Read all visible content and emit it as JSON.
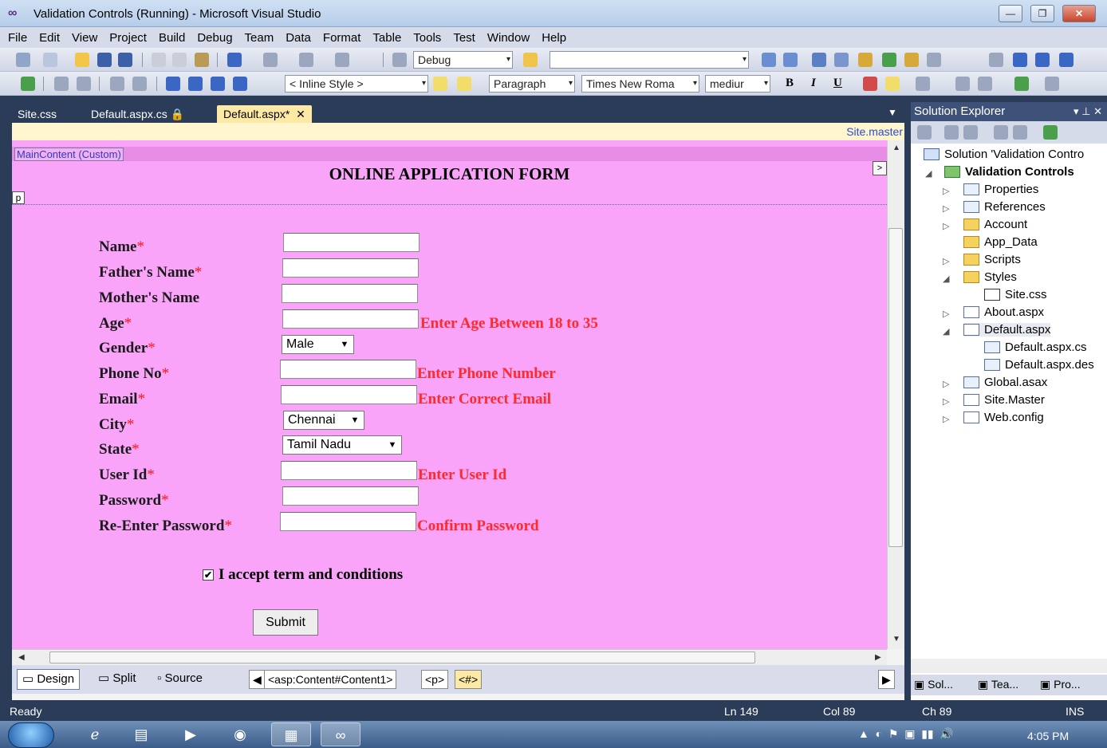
{
  "window": {
    "title": "Validation Controls (Running) - Microsoft Visual Studio",
    "title_icon": "∞"
  },
  "menu": [
    "File",
    "Edit",
    "View",
    "Project",
    "Build",
    "Debug",
    "Team",
    "Data",
    "Format",
    "Table",
    "Tools",
    "Test",
    "Window",
    "Help"
  ],
  "toolbar1": {
    "config_combo": "Debug",
    "search_combo": ""
  },
  "toolbar2": {
    "style_combo": "< Inline Style >",
    "block_combo": "Paragraph",
    "font_combo": "Times New Roma",
    "size_combo": "mediur",
    "bold": "B",
    "italic": "I",
    "underline": "U"
  },
  "tabs": {
    "site_css": "Site.css",
    "default_cs": "Default.aspx.cs",
    "lock": "🔒",
    "default_aspx": "Default.aspx*",
    "close": "✕"
  },
  "editor": {
    "master_link": "Site.master",
    "content_tag": "MainContent (Custom)",
    "p_tag": "p",
    "smart_tag": ">",
    "form_title": "ONLINE APPLICATION FORM"
  },
  "form": {
    "fields": [
      {
        "label": "Name",
        "req": "*"
      },
      {
        "label": "Father's Name",
        "req": "*"
      },
      {
        "label": "Mother's Name",
        "req": ""
      },
      {
        "label": "Age",
        "req": "*"
      },
      {
        "label": "Gender",
        "req": "*"
      },
      {
        "label": "Phone No",
        "req": "*"
      },
      {
        "label": "Email",
        "req": "*"
      },
      {
        "label": "City",
        "req": "*"
      },
      {
        "label": "State",
        "req": "*"
      },
      {
        "label": "User Id",
        "req": "*"
      },
      {
        "label": "Password",
        "req": "*"
      },
      {
        "label": "Re-Enter Password",
        "req": "*"
      }
    ],
    "gender_value": "Male",
    "city_value": "Chennai",
    "state_value": "Tamil Nadu",
    "errors": {
      "age": "Enter Age Between 18 to 35",
      "phone": "Enter Phone Number",
      "email": "Enter Correct Email",
      "userid": "Enter User Id",
      "confirm": "Confirm Password"
    },
    "terms_label": "I accept term and conditions",
    "terms_checked": "✔",
    "submit_label": "Submit"
  },
  "viewbar": {
    "design": "Design",
    "split": "Split",
    "source": "Source",
    "crumbs": [
      "<asp:Content#Content1>",
      "<p>",
      "<#>"
    ]
  },
  "solution_explorer": {
    "header": "Solution Explorer",
    "pins": "▾ ⊥ ✕",
    "items": [
      "Solution 'Validation Contro",
      "Validation Controls",
      "Properties",
      "References",
      "Account",
      "App_Data",
      "Scripts",
      "Styles",
      "Site.css",
      "About.aspx",
      "Default.aspx",
      "Default.aspx.cs",
      "Default.aspx.des",
      "Global.asax",
      "Site.Master",
      "Web.config"
    ],
    "bottom_tabs": [
      "Sol...",
      "Tea...",
      "Pro..."
    ]
  },
  "status": {
    "ready": "Ready",
    "ln": "Ln 149",
    "col": "Col 89",
    "ch": "Ch 89",
    "ins": "INS"
  },
  "taskbar": {
    "clock": "4:05 PM",
    "tray": "▲"
  }
}
